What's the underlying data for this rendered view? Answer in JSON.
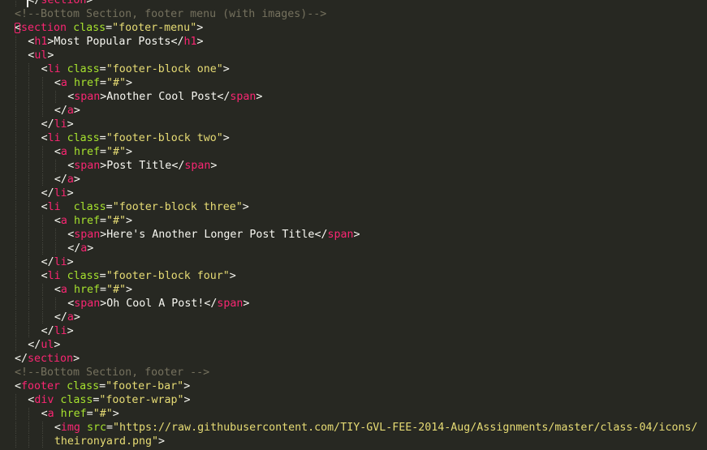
{
  "editor": {
    "lines": [
      {
        "indent": 1,
        "segments": [
          {
            "text": "</",
            "type": "punct"
          },
          {
            "text": "section",
            "type": "tag"
          },
          {
            "text": ">",
            "type": "punct"
          }
        ]
      },
      {
        "indent": 0,
        "segments": [
          {
            "text": "<!--Bottom Section, footer menu (with images)-->",
            "type": "comment"
          }
        ]
      },
      {
        "indent": 0,
        "mark": true,
        "segments": [
          {
            "text": "<",
            "type": "punct"
          },
          {
            "text": "section",
            "type": "tag"
          },
          {
            "text": " ",
            "type": "text"
          },
          {
            "text": "class",
            "type": "attr"
          },
          {
            "text": "=",
            "type": "punct"
          },
          {
            "text": "\"footer-menu\"",
            "type": "string"
          },
          {
            "text": ">",
            "type": "punct"
          }
        ]
      },
      {
        "indent": 1,
        "segments": [
          {
            "text": "<",
            "type": "punct"
          },
          {
            "text": "h1",
            "type": "tag"
          },
          {
            "text": ">",
            "type": "punct"
          },
          {
            "text": "Most Popular Posts",
            "type": "text"
          },
          {
            "text": "</",
            "type": "punct"
          },
          {
            "text": "h1",
            "type": "tag"
          },
          {
            "text": ">",
            "type": "punct"
          }
        ]
      },
      {
        "indent": 1,
        "segments": [
          {
            "text": "<",
            "type": "punct"
          },
          {
            "text": "ul",
            "type": "tag"
          },
          {
            "text": ">",
            "type": "punct"
          }
        ]
      },
      {
        "indent": 2,
        "segments": [
          {
            "text": "<",
            "type": "punct"
          },
          {
            "text": "li",
            "type": "tag"
          },
          {
            "text": " ",
            "type": "text"
          },
          {
            "text": "class",
            "type": "attr"
          },
          {
            "text": "=",
            "type": "punct"
          },
          {
            "text": "\"footer-block one\"",
            "type": "string"
          },
          {
            "text": ">",
            "type": "punct"
          }
        ]
      },
      {
        "indent": 3,
        "segments": [
          {
            "text": "<",
            "type": "punct"
          },
          {
            "text": "a",
            "type": "tag"
          },
          {
            "text": " ",
            "type": "text"
          },
          {
            "text": "href",
            "type": "attr"
          },
          {
            "text": "=",
            "type": "punct"
          },
          {
            "text": "\"#\"",
            "type": "string"
          },
          {
            "text": ">",
            "type": "punct"
          }
        ]
      },
      {
        "indent": 4,
        "segments": [
          {
            "text": "<",
            "type": "punct"
          },
          {
            "text": "span",
            "type": "tag"
          },
          {
            "text": ">",
            "type": "punct"
          },
          {
            "text": "Another Cool Post",
            "type": "text"
          },
          {
            "text": "</",
            "type": "punct"
          },
          {
            "text": "span",
            "type": "tag"
          },
          {
            "text": ">",
            "type": "punct"
          }
        ]
      },
      {
        "indent": 3,
        "segments": [
          {
            "text": "</",
            "type": "punct"
          },
          {
            "text": "a",
            "type": "tag"
          },
          {
            "text": ">",
            "type": "punct"
          }
        ]
      },
      {
        "indent": 2,
        "segments": [
          {
            "text": "</",
            "type": "punct"
          },
          {
            "text": "li",
            "type": "tag"
          },
          {
            "text": ">",
            "type": "punct"
          }
        ]
      },
      {
        "indent": 2,
        "segments": [
          {
            "text": "<",
            "type": "punct"
          },
          {
            "text": "li",
            "type": "tag"
          },
          {
            "text": " ",
            "type": "text"
          },
          {
            "text": "class",
            "type": "attr"
          },
          {
            "text": "=",
            "type": "punct"
          },
          {
            "text": "\"footer-block two\"",
            "type": "string"
          },
          {
            "text": ">",
            "type": "punct"
          }
        ]
      },
      {
        "indent": 3,
        "segments": [
          {
            "text": "<",
            "type": "punct"
          },
          {
            "text": "a",
            "type": "tag"
          },
          {
            "text": " ",
            "type": "text"
          },
          {
            "text": "href",
            "type": "attr"
          },
          {
            "text": "=",
            "type": "punct"
          },
          {
            "text": "\"#\"",
            "type": "string"
          },
          {
            "text": ">",
            "type": "punct"
          }
        ]
      },
      {
        "indent": 4,
        "segments": [
          {
            "text": "<",
            "type": "punct"
          },
          {
            "text": "span",
            "type": "tag"
          },
          {
            "text": ">",
            "type": "punct"
          },
          {
            "text": "Post Title",
            "type": "text"
          },
          {
            "text": "</",
            "type": "punct"
          },
          {
            "text": "span",
            "type": "tag"
          },
          {
            "text": ">",
            "type": "punct"
          }
        ]
      },
      {
        "indent": 3,
        "segments": [
          {
            "text": "</",
            "type": "punct"
          },
          {
            "text": "a",
            "type": "tag"
          },
          {
            "text": ">",
            "type": "punct"
          }
        ]
      },
      {
        "indent": 2,
        "segments": [
          {
            "text": "</",
            "type": "punct"
          },
          {
            "text": "li",
            "type": "tag"
          },
          {
            "text": ">",
            "type": "punct"
          }
        ]
      },
      {
        "indent": 2,
        "segments": [
          {
            "text": "<",
            "type": "punct"
          },
          {
            "text": "li",
            "type": "tag"
          },
          {
            "text": "  ",
            "type": "text"
          },
          {
            "text": "class",
            "type": "attr"
          },
          {
            "text": "=",
            "type": "punct"
          },
          {
            "text": "\"footer-block three\"",
            "type": "string"
          },
          {
            "text": ">",
            "type": "punct"
          }
        ]
      },
      {
        "indent": 3,
        "segments": [
          {
            "text": "<",
            "type": "punct"
          },
          {
            "text": "a",
            "type": "tag"
          },
          {
            "text": " ",
            "type": "text"
          },
          {
            "text": "href",
            "type": "attr"
          },
          {
            "text": "=",
            "type": "punct"
          },
          {
            "text": "\"#\"",
            "type": "string"
          },
          {
            "text": ">",
            "type": "punct"
          }
        ]
      },
      {
        "indent": 4,
        "segments": [
          {
            "text": "<",
            "type": "punct"
          },
          {
            "text": "span",
            "type": "tag"
          },
          {
            "text": ">",
            "type": "punct"
          },
          {
            "text": "Here's Another Longer Post Title",
            "type": "text"
          },
          {
            "text": "</",
            "type": "punct"
          },
          {
            "text": "span",
            "type": "tag"
          },
          {
            "text": ">",
            "type": "punct"
          }
        ]
      },
      {
        "indent": 4,
        "segments": [
          {
            "text": "</",
            "type": "punct"
          },
          {
            "text": "a",
            "type": "tag"
          },
          {
            "text": ">",
            "type": "punct"
          }
        ]
      },
      {
        "indent": 2,
        "segments": [
          {
            "text": "</",
            "type": "punct"
          },
          {
            "text": "li",
            "type": "tag"
          },
          {
            "text": ">",
            "type": "punct"
          }
        ]
      },
      {
        "indent": 2,
        "segments": [
          {
            "text": "<",
            "type": "punct"
          },
          {
            "text": "li",
            "type": "tag"
          },
          {
            "text": " ",
            "type": "text"
          },
          {
            "text": "class",
            "type": "attr"
          },
          {
            "text": "=",
            "type": "punct"
          },
          {
            "text": "\"footer-block four\"",
            "type": "string"
          },
          {
            "text": ">",
            "type": "punct"
          }
        ]
      },
      {
        "indent": 3,
        "segments": [
          {
            "text": "<",
            "type": "punct"
          },
          {
            "text": "a",
            "type": "tag"
          },
          {
            "text": " ",
            "type": "text"
          },
          {
            "text": "href",
            "type": "attr"
          },
          {
            "text": "=",
            "type": "punct"
          },
          {
            "text": "\"#\"",
            "type": "string"
          },
          {
            "text": ">",
            "type": "punct"
          }
        ]
      },
      {
        "indent": 4,
        "segments": [
          {
            "text": "<",
            "type": "punct"
          },
          {
            "text": "span",
            "type": "tag"
          },
          {
            "text": ">",
            "type": "punct"
          },
          {
            "text": "Oh Cool A Post!",
            "type": "text"
          },
          {
            "text": "</",
            "type": "punct"
          },
          {
            "text": "span",
            "type": "tag"
          },
          {
            "text": ">",
            "type": "punct"
          }
        ]
      },
      {
        "indent": 3,
        "segments": [
          {
            "text": "</",
            "type": "punct"
          },
          {
            "text": "a",
            "type": "tag"
          },
          {
            "text": ">",
            "type": "punct"
          }
        ]
      },
      {
        "indent": 2,
        "segments": [
          {
            "text": "</",
            "type": "punct"
          },
          {
            "text": "li",
            "type": "tag"
          },
          {
            "text": ">",
            "type": "punct"
          }
        ]
      },
      {
        "indent": 1,
        "segments": [
          {
            "text": "</",
            "type": "punct"
          },
          {
            "text": "ul",
            "type": "tag"
          },
          {
            "text": ">",
            "type": "punct"
          }
        ]
      },
      {
        "indent": 0,
        "segments": [
          {
            "text": "</",
            "type": "punct"
          },
          {
            "text": "section",
            "type": "tag"
          },
          {
            "text": ">",
            "type": "punct"
          }
        ]
      },
      {
        "indent": 0,
        "segments": [
          {
            "text": "<!--Bottom Section, footer -->",
            "type": "comment"
          }
        ]
      },
      {
        "indent": 0,
        "segments": [
          {
            "text": "<",
            "type": "punct"
          },
          {
            "text": "footer",
            "type": "tag"
          },
          {
            "text": " ",
            "type": "text"
          },
          {
            "text": "class",
            "type": "attr"
          },
          {
            "text": "=",
            "type": "punct"
          },
          {
            "text": "\"footer-bar\"",
            "type": "string"
          },
          {
            "text": ">",
            "type": "punct"
          }
        ]
      },
      {
        "indent": 1,
        "segments": [
          {
            "text": "<",
            "type": "punct"
          },
          {
            "text": "div",
            "type": "tag"
          },
          {
            "text": " ",
            "type": "text"
          },
          {
            "text": "class",
            "type": "attr"
          },
          {
            "text": "=",
            "type": "punct"
          },
          {
            "text": "\"footer-wrap\"",
            "type": "string"
          },
          {
            "text": ">",
            "type": "punct"
          }
        ]
      },
      {
        "indent": 2,
        "segments": [
          {
            "text": "<",
            "type": "punct"
          },
          {
            "text": "a",
            "type": "tag"
          },
          {
            "text": " ",
            "type": "text"
          },
          {
            "text": "href",
            "type": "attr"
          },
          {
            "text": "=",
            "type": "punct"
          },
          {
            "text": "\"#\"",
            "type": "string"
          },
          {
            "text": ">",
            "type": "punct"
          }
        ]
      },
      {
        "indent": 3,
        "segments": [
          {
            "text": "<",
            "type": "punct"
          },
          {
            "text": "img",
            "type": "tag"
          },
          {
            "text": " ",
            "type": "text"
          },
          {
            "text": "src",
            "type": "attr"
          },
          {
            "text": "=",
            "type": "punct"
          },
          {
            "text": "\"https://raw.githubusercontent.com/TIY-GVL-FEE-2014-Aug/Assignments/master/class-04/icons/",
            "type": "string"
          }
        ]
      },
      {
        "indent": 3,
        "segments": [
          {
            "text": "theironyard.png\"",
            "type": "string"
          },
          {
            "text": ">",
            "type": "punct"
          }
        ]
      }
    ]
  }
}
